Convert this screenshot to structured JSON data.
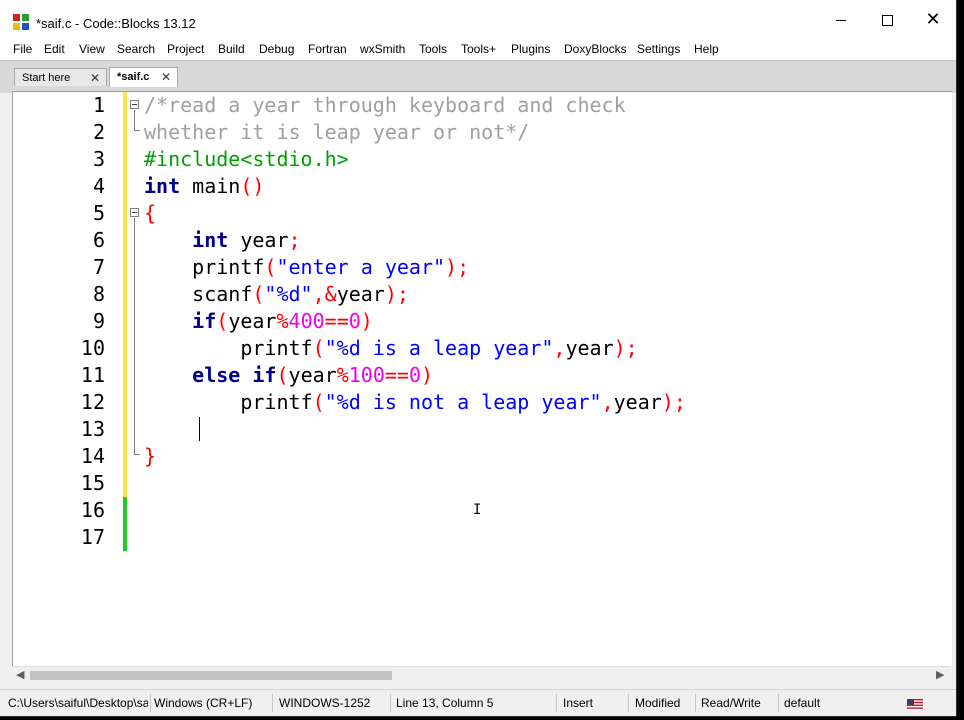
{
  "window": {
    "title": "*saif.c - Code::Blocks 13.12",
    "controls": {
      "minimize": "minimize",
      "maximize": "maximize",
      "close": "✕"
    }
  },
  "menu": [
    "File",
    "Edit",
    "View",
    "Search",
    "Project",
    "Build",
    "Debug",
    "Fortran",
    "wxSmith",
    "Tools",
    "Tools+",
    "Plugins",
    "DoxyBlocks",
    "Settings",
    "Help"
  ],
  "tabs": [
    {
      "label": "Start here",
      "close": "✕",
      "active": false
    },
    {
      "label": "*saif.c",
      "close": "✕",
      "active": true
    }
  ],
  "editor": {
    "line_numbers": [
      "1",
      "2",
      "3",
      "4",
      "5",
      "6",
      "7",
      "8",
      "9",
      "10",
      "11",
      "12",
      "13",
      "14",
      "15",
      "16",
      "17"
    ],
    "lines": [
      [
        {
          "t": "/*read a year through keyboard and check",
          "c": "cm"
        }
      ],
      [
        {
          "t": "whether it is leap year or not*/",
          "c": "cm"
        }
      ],
      [
        {
          "t": "#include<stdio.h>",
          "c": "pp"
        }
      ],
      [
        {
          "t": "int",
          "c": "kw"
        },
        {
          "t": " main",
          "c": ""
        },
        {
          "t": "()",
          "c": "op"
        }
      ],
      [
        {
          "t": "{",
          "c": "op"
        }
      ],
      [
        {
          "t": "    ",
          "c": ""
        },
        {
          "t": "int",
          "c": "kw"
        },
        {
          "t": " year",
          "c": ""
        },
        {
          "t": ";",
          "c": "op"
        }
      ],
      [
        {
          "t": "    printf",
          "c": ""
        },
        {
          "t": "(",
          "c": "op"
        },
        {
          "t": "\"enter a year\"",
          "c": "str"
        },
        {
          "t": ");",
          "c": "op"
        }
      ],
      [
        {
          "t": "    scanf",
          "c": ""
        },
        {
          "t": "(",
          "c": "op"
        },
        {
          "t": "\"%d\"",
          "c": "str"
        },
        {
          "t": ",&",
          "c": "op"
        },
        {
          "t": "year",
          "c": ""
        },
        {
          "t": ");",
          "c": "op"
        }
      ],
      [
        {
          "t": "    ",
          "c": ""
        },
        {
          "t": "if",
          "c": "kw"
        },
        {
          "t": "(",
          "c": "op"
        },
        {
          "t": "year",
          "c": ""
        },
        {
          "t": "%",
          "c": "op"
        },
        {
          "t": "400",
          "c": "num"
        },
        {
          "t": "==",
          "c": "op"
        },
        {
          "t": "0",
          "c": "num"
        },
        {
          "t": ")",
          "c": "op"
        }
      ],
      [
        {
          "t": "        printf",
          "c": ""
        },
        {
          "t": "(",
          "c": "op"
        },
        {
          "t": "\"%d is a leap year\"",
          "c": "str"
        },
        {
          "t": ",",
          "c": "op"
        },
        {
          "t": "year",
          "c": ""
        },
        {
          "t": ");",
          "c": "op"
        }
      ],
      [
        {
          "t": "    ",
          "c": ""
        },
        {
          "t": "else",
          "c": "kw"
        },
        {
          "t": " ",
          "c": ""
        },
        {
          "t": "if",
          "c": "kw"
        },
        {
          "t": "(",
          "c": "op"
        },
        {
          "t": "year",
          "c": ""
        },
        {
          "t": "%",
          "c": "op"
        },
        {
          "t": "100",
          "c": "num"
        },
        {
          "t": "==",
          "c": "op"
        },
        {
          "t": "0",
          "c": "num"
        },
        {
          "t": ")",
          "c": "op"
        }
      ],
      [
        {
          "t": "        printf",
          "c": ""
        },
        {
          "t": "(",
          "c": "op"
        },
        {
          "t": "\"%d is not a leap year\"",
          "c": "str"
        },
        {
          "t": ",",
          "c": "op"
        },
        {
          "t": "year",
          "c": ""
        },
        {
          "t": ");",
          "c": "op"
        }
      ],
      [
        {
          "t": "",
          "c": ""
        }
      ],
      [
        {
          "t": "}",
          "c": "op"
        }
      ],
      [
        {
          "t": "",
          "c": ""
        }
      ],
      [
        {
          "t": "",
          "c": ""
        }
      ],
      [
        {
          "t": "",
          "c": ""
        }
      ]
    ],
    "modified_lines": [
      1,
      2,
      3,
      4,
      5,
      6,
      7,
      8,
      9,
      10,
      11,
      12,
      13,
      14,
      15
    ],
    "saved_lines": [
      16,
      17
    ]
  },
  "colors": {
    "modified_marker": "#ffe34d",
    "saved_marker": "#28c828",
    "comment": "#a0a0a0",
    "preprocessor": "#00a000",
    "keyword": "#00008b",
    "string": "#0000ff",
    "operator": "#ff0000",
    "number": "#f000f0"
  },
  "statusbar": {
    "path": "C:\\Users\\saiful\\Desktop\\sa",
    "eol": "Windows (CR+LF)",
    "encoding": "WINDOWS-1252",
    "position": "Line 13, Column 5",
    "mode": "Insert",
    "state": "Modified",
    "access": "Read/Write",
    "lang": "default"
  }
}
